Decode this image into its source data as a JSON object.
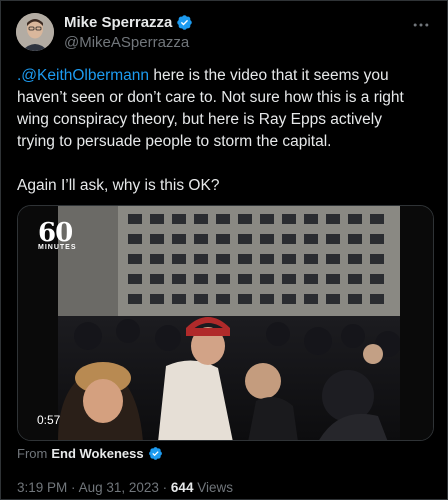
{
  "author": {
    "name": "Mike Sperrazza",
    "handle": "@MikeASperrazza"
  },
  "tweet": {
    "mention": ".@KeithOlbermann",
    "text_after_mention": " here is the video that it seems you haven’t seen or don’t care to. Not sure how this is a right wing conspiracy theory, but here is Ray Epps actively trying to persuade people to storm the capital.",
    "paragraph2": "Again I’ll ask, why is this OK?"
  },
  "media": {
    "logo_number": "60",
    "logo_sub": "MINUTES",
    "duration": "0:57"
  },
  "source": {
    "prefix": "From",
    "name": "End Wokeness"
  },
  "meta": {
    "time": "3:19 PM",
    "sep1": "·",
    "date": "Aug 31, 2023",
    "sep2": "·",
    "views_count": "644",
    "views_label": "Views"
  },
  "colors": {
    "background": "#000000",
    "text": "#e7e9ea",
    "secondary": "#71767b",
    "accent": "#1d9bf0"
  },
  "icons": [
    "more-icon",
    "verified-badge-icon",
    "play-video"
  ]
}
